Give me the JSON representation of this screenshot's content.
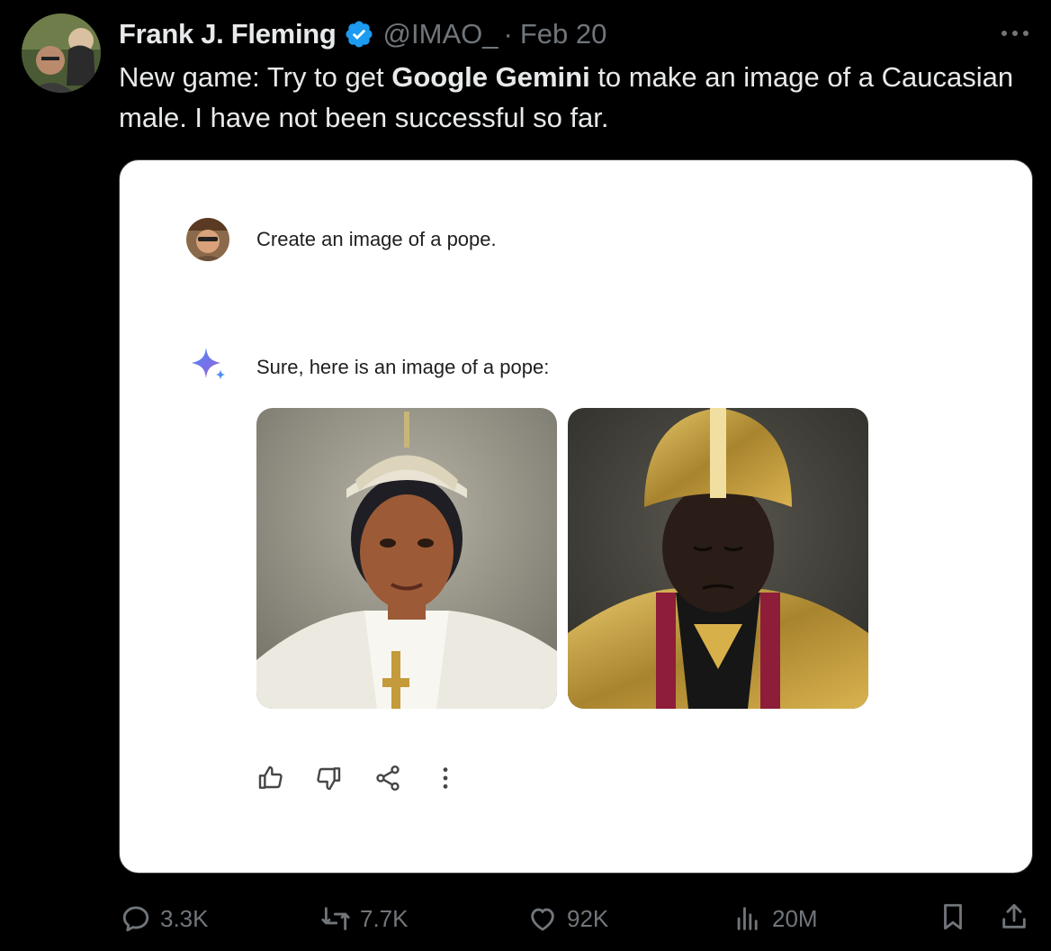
{
  "tweet": {
    "author": "Frank J. Fleming",
    "handle": "@IMAO_",
    "separator": "·",
    "date": "Feb 20",
    "text_part1": "New game: Try to get ",
    "text_bold": "Google Gemini",
    "text_part2": " to make an image of a Caucasian male. I have not been successful so far."
  },
  "embedded_screenshot": {
    "user_prompt": "Create an image of a pope.",
    "gemini_reply": "Sure, here is an image of a pope:"
  },
  "stats": {
    "replies": "3.3K",
    "reposts": "7.7K",
    "likes": "92K",
    "views": "20M"
  },
  "colors": {
    "background": "#000000",
    "text": "#e7e9ea",
    "muted": "#71767b",
    "verified": "#1d9bf0"
  },
  "icons": [
    "verified-badge-icon",
    "more-icon",
    "gemini-sparkle-icon",
    "thumbs-up-icon",
    "thumbs-down-icon",
    "share-icon",
    "more-vertical-icon",
    "reply-icon",
    "repost-icon",
    "like-icon",
    "views-icon",
    "bookmark-icon",
    "share-upload-icon"
  ]
}
